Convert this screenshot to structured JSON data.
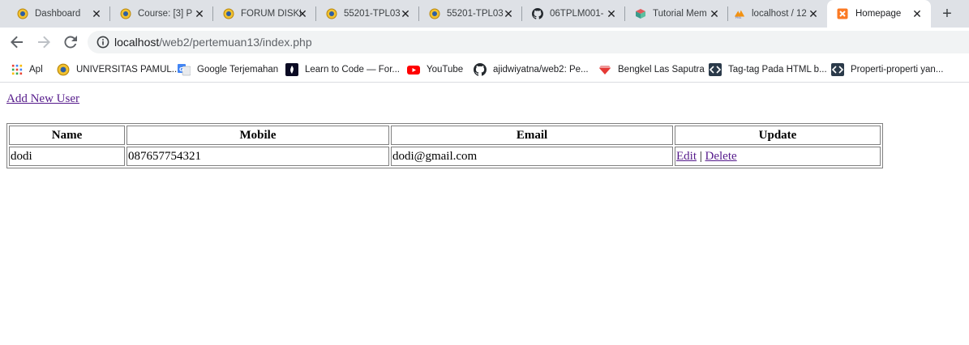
{
  "browser": {
    "tabs": [
      {
        "title": "Dashboard",
        "icon": "university-logo-icon"
      },
      {
        "title": "Course: [3] P",
        "icon": "university-logo-icon"
      },
      {
        "title": "FORUM DISKU",
        "icon": "university-logo-icon"
      },
      {
        "title": "55201-TPL03",
        "icon": "university-logo-icon"
      },
      {
        "title": "55201-TPL03",
        "icon": "university-logo-icon"
      },
      {
        "title": "06TPLM001-",
        "icon": "github-icon"
      },
      {
        "title": "Tutorial Mem",
        "icon": "tutorial-cube-icon"
      },
      {
        "title": "localhost / 12",
        "icon": "phpmyadmin-icon"
      },
      {
        "title": "Homepage",
        "icon": "xampp-icon",
        "active": true
      }
    ],
    "url": {
      "host": "localhost",
      "path": "/web2/pertemuan13/index.php"
    },
    "bookmarks": [
      {
        "label": "Apl",
        "icon": "apps-grid-icon"
      },
      {
        "label": "UNIVERSITAS PAMUL...",
        "icon": "university-logo-icon"
      },
      {
        "label": "Google Terjemahan",
        "icon": "google-translate-icon"
      },
      {
        "label": "Learn to Code — For...",
        "icon": "freecodecamp-icon"
      },
      {
        "label": "YouTube",
        "icon": "youtube-icon"
      },
      {
        "label": "ajidwiyatna/web2: Pe...",
        "icon": "github-icon"
      },
      {
        "label": "Bengkel Las Saputra",
        "icon": "gem-icon"
      },
      {
        "label": "Tag-tag Pada HTML b...",
        "icon": "code-icon"
      },
      {
        "label": "Properti-properti yan...",
        "icon": "code-icon"
      }
    ]
  },
  "page": {
    "add_link": "Add New User",
    "table": {
      "headers": [
        "Name",
        "Mobile",
        "Email",
        "Update"
      ],
      "rows": [
        {
          "name": "dodi",
          "mobile": "087657754321",
          "email": "dodi@gmail.com",
          "edit": "Edit",
          "sep": "|",
          "delete": "Delete"
        }
      ]
    }
  },
  "colors": {
    "tabstrip": "#dee1e6",
    "omnibox": "#f1f3f4",
    "visited_link": "#551a8b"
  }
}
